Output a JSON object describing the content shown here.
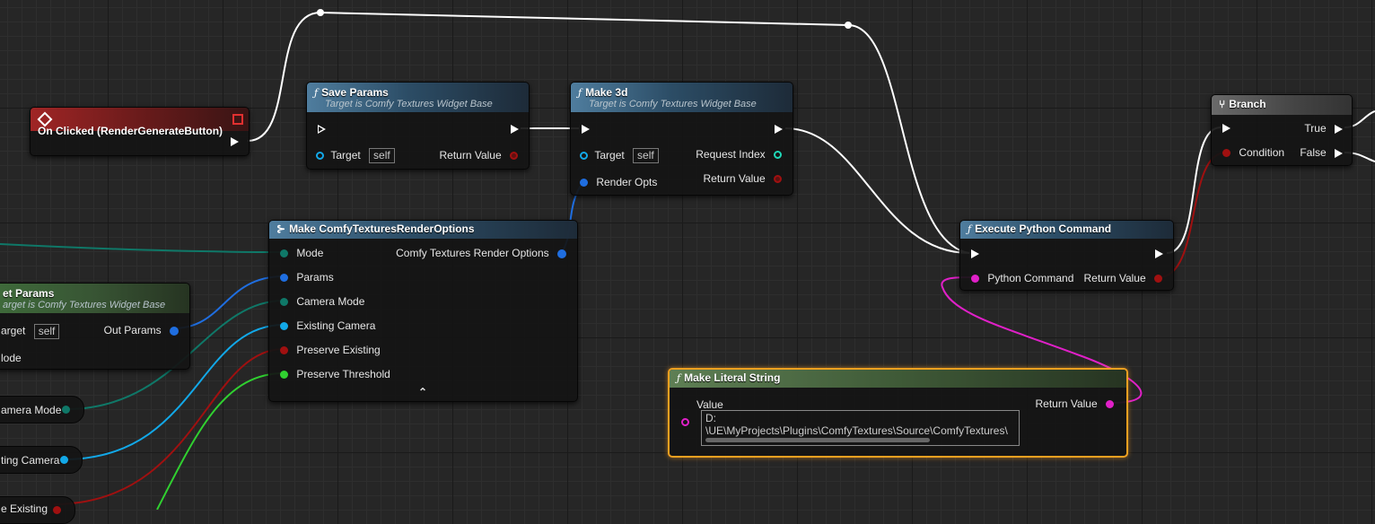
{
  "nodes": {
    "on_clicked": {
      "title": "On Clicked (RenderGenerateButton)"
    },
    "save_params": {
      "title": "Save Params",
      "subtitle": "Target is Comfy Textures Widget Base",
      "target_label": "Target",
      "target_value": "self",
      "return_label": "Return Value"
    },
    "make_3d": {
      "title": "Make 3d",
      "subtitle": "Target is Comfy Textures Widget Base",
      "target_label": "Target",
      "target_value": "self",
      "request_index_label": "Request Index",
      "render_opts_label": "Render Opts",
      "return_label": "Return Value"
    },
    "make_render_options": {
      "title": "Make ComfyTexturesRenderOptions",
      "output_label": "Comfy Textures Render Options",
      "inputs": [
        "Mode",
        "Params",
        "Camera Mode",
        "Existing Camera",
        "Preserve Existing",
        "Preserve Threshold"
      ],
      "collapse_glyph": "⌃"
    },
    "get_params": {
      "title": "et Params",
      "subtitle": "arget is Comfy Textures Widget Base",
      "target_label": "arget",
      "target_value": "self",
      "out_params_label": "Out Params",
      "mode_label": "lode"
    },
    "execute_python": {
      "title": "Execute Python Command",
      "python_command_label": "Python Command",
      "return_label": "Return Value"
    },
    "branch": {
      "title": "Branch",
      "condition_label": "Condition",
      "true_label": "True",
      "false_label": "False"
    },
    "make_literal_string": {
      "title": "Make Literal String",
      "value_label": "Value",
      "value_line1": "D:",
      "value_line2": "\\UE\\MyProjects\\Plugins\\ComfyTextures\\Source\\ComfyTextures\\",
      "return_label": "Return Value"
    },
    "var_camera_mode": {
      "label": "amera Mode"
    },
    "var_existing_camera": {
      "label": "ting Camera"
    },
    "var_preserve_existing": {
      "label": "e Existing"
    }
  },
  "colors": {
    "exec_wire": "#ffffff",
    "struct_pin": "#1f6ee0",
    "object_pin": "#12a8e8",
    "enum_pin": "#0f7868",
    "bool_pin": "#a01010",
    "float_pin": "#30d030",
    "string_pin": "#e020c8",
    "int_pin": "#1fd8b8",
    "selection": "#f0a020"
  }
}
